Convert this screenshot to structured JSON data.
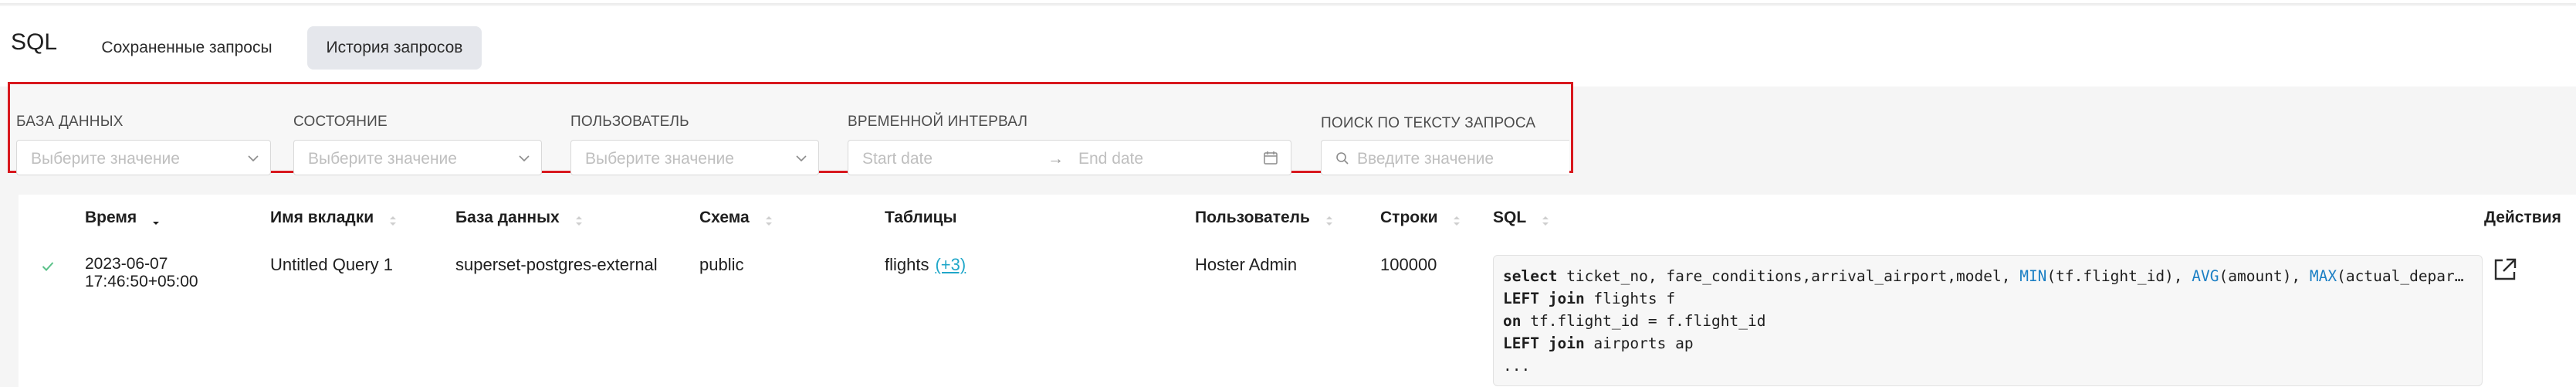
{
  "header": {
    "title": "SQL",
    "tabs": [
      {
        "label": "Сохраненные запросы",
        "active": false
      },
      {
        "label": "История запросов",
        "active": true
      }
    ]
  },
  "filters": {
    "database": {
      "label": "БАЗА ДАННЫХ",
      "placeholder": "Выберите значение"
    },
    "state": {
      "label": "СОСТОЯНИЕ",
      "placeholder": "Выберите значение"
    },
    "user": {
      "label": "ПОЛЬЗОВАТЕЛЬ",
      "placeholder": "Выберите значение"
    },
    "time_range": {
      "label": "ВРЕМЕННОЙ ИНТЕРВАЛ",
      "start_placeholder": "Start date",
      "end_placeholder": "End date",
      "arrow": "→"
    },
    "search": {
      "label": "ПОИСК ПО ТЕКСТУ ЗАПРОСА",
      "placeholder": "Введите значение"
    }
  },
  "table": {
    "columns": {
      "time": "Время",
      "tab_name": "Имя вкладки",
      "database": "База данных",
      "schema": "Схема",
      "tables": "Таблицы",
      "user": "Пользователь",
      "rows": "Строки",
      "sql": "SQL",
      "actions": "Действия"
    },
    "rows": [
      {
        "status": "success",
        "date": "2023-06-07",
        "time": "17:46:50+05:00",
        "tab_name": "Untitled Query 1",
        "database": "superset-postgres-external",
        "schema": "public",
        "tables": "flights",
        "tables_more": "(+3)",
        "user": "Hoster Admin",
        "rows": "100000",
        "sql_lines": [
          "select ticket_no, fare_conditions,arrival_airport,model, MIN(tf.flight_id), AVG(amount), MAX(actual_departure)",
          "LEFT join flights f",
          "on tf.flight_id = f.flight_id",
          "LEFT join airports ap",
          "..."
        ]
      }
    ]
  },
  "colors": {
    "accent": "#20a7c9",
    "success": "#5ac189",
    "highlight_border": "#d8181e",
    "sql_function": "#1b7fc4"
  },
  "icons": {
    "select_arrow": "chevron-down-icon",
    "calendar": "calendar-icon",
    "search": "search-icon",
    "success": "check-icon",
    "open": "external-link-icon",
    "sort": "sort-icon"
  }
}
